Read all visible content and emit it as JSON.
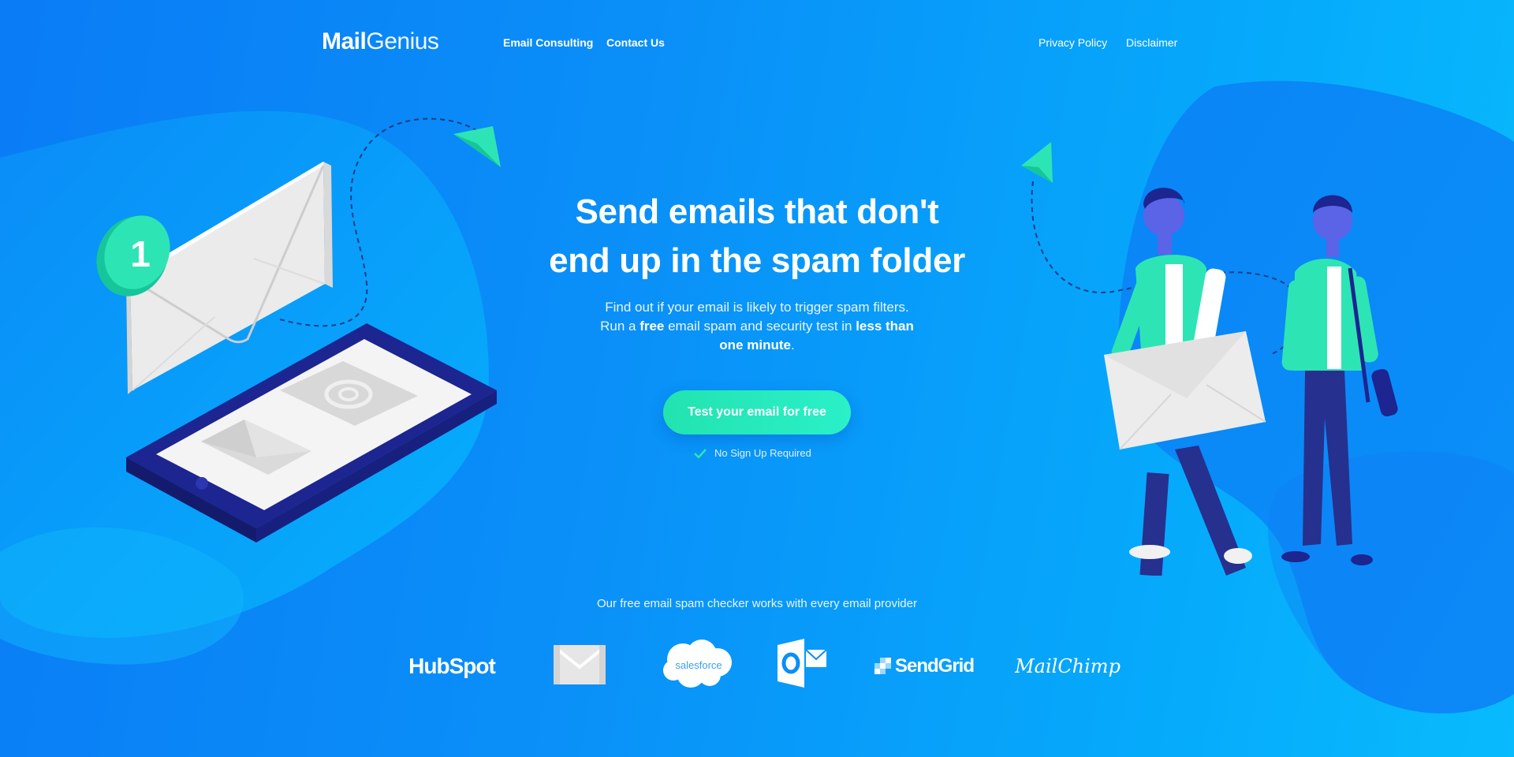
{
  "nav": {
    "logo_bold": "Mail",
    "logo_light": "Genius",
    "links_left": [
      "Email Consulting",
      "Contact Us"
    ],
    "links_right": [
      "Privacy Policy",
      "Disclaimer"
    ]
  },
  "hero": {
    "title_line1": "Send emails that don't",
    "title_line2": "end up in the spam folder",
    "sub_part1": "Find out if your email is likely to trigger spam filters. Run a ",
    "sub_bold1": "free",
    "sub_part2": " email spam and security test in ",
    "sub_bold2": "less than one minute",
    "sub_part3": ".",
    "cta_label": "Test your email for free",
    "note": "No Sign Up Required"
  },
  "illustration": {
    "badge_number": "1"
  },
  "providers": {
    "caption": "Our free email spam checker works with every email provider",
    "logos": [
      "HubSpot",
      "Gmail",
      "salesforce",
      "Outlook",
      "SendGrid",
      "MailChimp"
    ]
  },
  "colors": {
    "accent": "#22e3b0",
    "bg_start": "#0a7cf6",
    "bg_end": "#08bbfd",
    "phone": "#2431a8"
  },
  "icons": [
    "check-icon",
    "envelope-icon",
    "at-icon",
    "paper-plane-icon"
  ]
}
